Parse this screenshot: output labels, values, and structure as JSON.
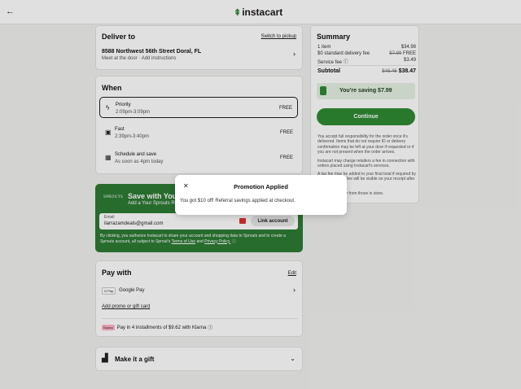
{
  "header": {
    "back_label": "←",
    "logo_text": "instacart",
    "logo_carrot": "⇞"
  },
  "deliver": {
    "title": "Deliver to",
    "switch_label": "Switch to pickup",
    "address": "8588 Northwest 56th Street Doral, FL",
    "instructions": "Meet at the door · Add instructions"
  },
  "when": {
    "title": "When",
    "options": [
      {
        "name": "Priority",
        "time": "2:09pm-3:09pm",
        "price": "FREE",
        "icon": "bolt-icon",
        "glyph": "ϟ"
      },
      {
        "name": "Fast",
        "time": "2:39pm-3:40pm",
        "price": "FREE",
        "icon": "bag-icon",
        "glyph": "▣"
      },
      {
        "name": "Schedule and save",
        "time": "As soon as 4pm today",
        "price": "FREE",
        "icon": "calendar-icon",
        "glyph": "▦"
      }
    ]
  },
  "sprouts": {
    "brand": "SPROUTS",
    "title": "Save with Your",
    "subtitle": "Add a Your Sprouts R",
    "email_label": "Email",
    "email_value": "ilarrazamdeals@gmail.com",
    "link_button": "Link account",
    "disclaimer": "By clicking, you authorize Instacart to share your account and shopping data to Sprouts and to create a Sprouts account, all subject to Sprout's",
    "terms_link": "Terms of Use",
    "and_text": "and",
    "privacy_link": "Privacy Policy.",
    "accent": "#2d7a34"
  },
  "pay": {
    "title": "Pay with",
    "edit_label": "Edit",
    "gpay_badge": "G Pay",
    "method": "Google Pay",
    "promo_link": "Add promo or gift card",
    "klarna_badge": "Klarna",
    "klarna_text": "Pay in 4 installments of $9.62 with Klarna",
    "klarna_color": "#ffb3c7"
  },
  "gift": {
    "title": "Make it a gift"
  },
  "summary": {
    "title": "Summary",
    "rows": [
      {
        "label": "1 item",
        "value": "$34.98",
        "strike": ""
      },
      {
        "label": "$0 standard delivery fee",
        "value": "FREE",
        "strike": "$7.99"
      },
      {
        "label": "Service fee",
        "value": "$3.49",
        "strike": ""
      }
    ],
    "subtotal_label": "Subtotal",
    "subtotal_strike": "$46.46",
    "subtotal_value": "$38.47",
    "saving": "You're saving $7.99",
    "continue_label": "Continue",
    "para1": "You accept full responsibility for the order once it's delivered. Items that do not require ID or delivery confirmation may be left at your door if requested or if you are not present when the order arrives.",
    "para2": "Instacart may charge retailers a fee in connection with orders placed using Instacart's services.",
    "para3": "A tax fee may be added to your final total if required by the retailer. The fee will be visible on your receipt after delivery.",
    "para4": "Prices may differ from those in store."
  },
  "modal": {
    "title": "Promotion Applied",
    "message": "You got $10 off! Referral savings applied at checkout.",
    "close": "✕"
  }
}
